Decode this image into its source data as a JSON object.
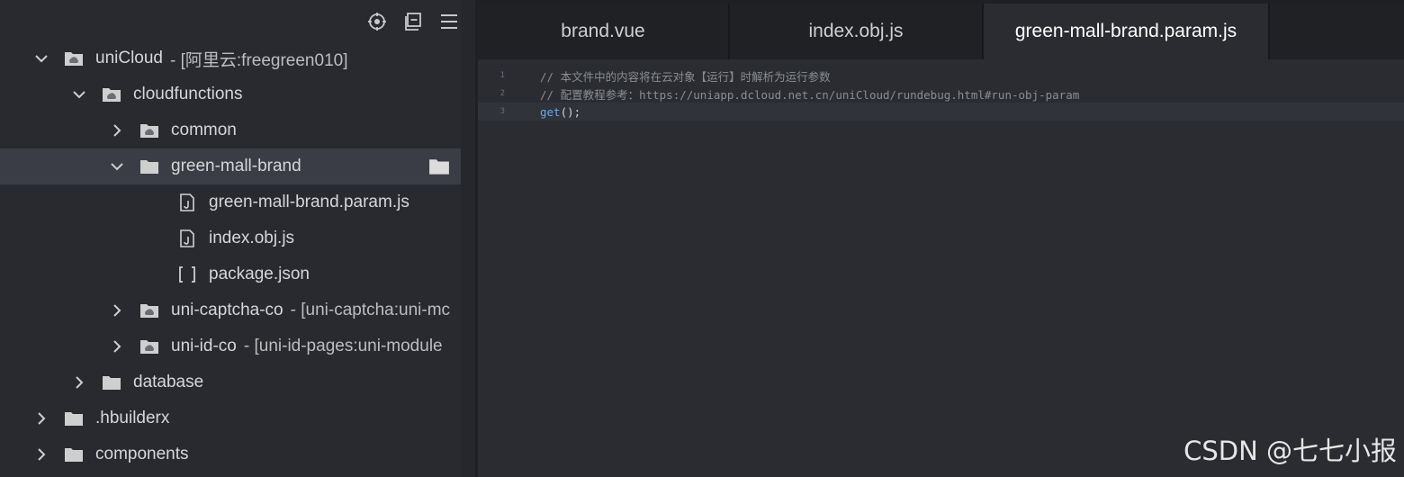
{
  "sidebar": {
    "toolbar": [
      {
        "icon": "locate-icon"
      },
      {
        "icon": "collapse-all-icon"
      },
      {
        "icon": "menu-icon"
      }
    ],
    "tree": [
      {
        "label": "uniCloud",
        "suffix": "- [阿里云:freegreen010]",
        "depth": 0,
        "expanded": true,
        "icon": "cloud-folder-icon"
      },
      {
        "label": "cloudfunctions",
        "suffix": "",
        "depth": 1,
        "expanded": true,
        "icon": "cloud-folder-icon"
      },
      {
        "label": "common",
        "suffix": "",
        "depth": 2,
        "expanded": false,
        "icon": "cloud-folder-icon"
      },
      {
        "label": "green-mall-brand",
        "suffix": "",
        "depth": 2,
        "expanded": true,
        "icon": "folder-icon",
        "selected": true
      },
      {
        "label": "green-mall-brand.param.js",
        "suffix": "",
        "depth": 3,
        "icon": "js-file-icon"
      },
      {
        "label": "index.obj.js",
        "suffix": "",
        "depth": 3,
        "icon": "js-file-icon"
      },
      {
        "label": "package.json",
        "suffix": "",
        "depth": 3,
        "icon": "json-file-icon"
      },
      {
        "label": "uni-captcha-co",
        "suffix": "- [uni-captcha:uni-mc",
        "depth": 2,
        "expanded": false,
        "icon": "cloud-folder-icon"
      },
      {
        "label": "uni-id-co",
        "suffix": "- [uni-id-pages:uni-module",
        "depth": 2,
        "expanded": false,
        "icon": "cloud-folder-icon"
      },
      {
        "label": "database",
        "suffix": "",
        "depth": 1,
        "expanded": false,
        "icon": "folder-icon"
      },
      {
        "label": ".hbuilderx",
        "suffix": "",
        "depth": 0,
        "expanded": false,
        "icon": "folder-icon"
      },
      {
        "label": "components",
        "suffix": "",
        "depth": 0,
        "expanded": false,
        "icon": "folder-icon"
      }
    ]
  },
  "editor": {
    "tabs": [
      {
        "label": "brand.vue",
        "active": false
      },
      {
        "label": "index.obj.js",
        "active": false
      },
      {
        "label": "green-mall-brand.param.js",
        "active": true
      }
    ],
    "lines": [
      {
        "num": "1",
        "text": "// 本文件中的内容将在云对象【运行】时解析为运行参数",
        "kind": "comment"
      },
      {
        "num": "2",
        "text": "// 配置教程参考：https://uniapp.dcloud.net.cn/uniCloud/rundebug.html#run-obj-param",
        "kind": "comment"
      },
      {
        "num": "3",
        "fn": "get",
        "rest": "();",
        "kind": "code",
        "current": true
      }
    ]
  },
  "watermark": "CSDN @七七小报",
  "colors": {
    "sidebar_bg": "#282a30",
    "editor_bg": "#2a2c31",
    "tabbar_bg": "#1f2125",
    "selected_row": "#3a3d45",
    "comment": "#8a8d92",
    "function": "#6fa8e8"
  }
}
